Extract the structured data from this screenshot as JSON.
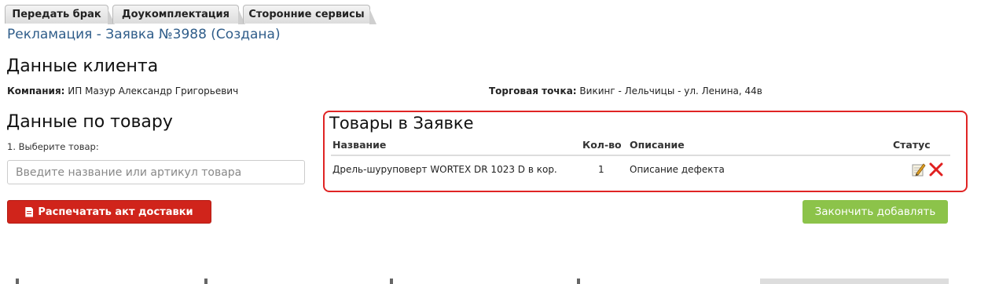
{
  "tabs": [
    {
      "label": "Передать брак"
    },
    {
      "label": "Доукомплектация"
    },
    {
      "label": "Сторонние сервисы"
    }
  ],
  "page_title": "Рекламация - Заявка №3988 (Создана)",
  "client": {
    "heading": "Данные клиента",
    "company_label": "Компания:",
    "company_value": "ИП Мазур Александр Григорьевич",
    "shop_label": "Торговая точка:",
    "shop_value": "Викинг - Лельчицы - ул. Ленина, 44в"
  },
  "product": {
    "heading": "Данные по товару",
    "step_label": "1. Выберите товар:",
    "search_placeholder": "Введите название или артикул товара",
    "print_button": "Распечатать акт доставки"
  },
  "items": {
    "heading": "Товары в Заявке",
    "columns": {
      "name": "Название",
      "qty": "Кол-во",
      "desc": "Описание",
      "status": "Статус"
    },
    "rows": [
      {
        "name": "Дрель-шуруповерт WORTEX DR 1023 D в кор.",
        "qty": "1",
        "desc": "Описание дефекта"
      }
    ]
  },
  "finish_button": "Закончить добавлять",
  "colors": {
    "title": "#2f5d8a",
    "print_button": "#d0241b",
    "finish_button": "#8cc34a",
    "highlight": "#e02424"
  },
  "icons": {
    "edit": "pencil-edit-icon",
    "delete": "red-x-delete-icon",
    "print": "document-icon"
  }
}
